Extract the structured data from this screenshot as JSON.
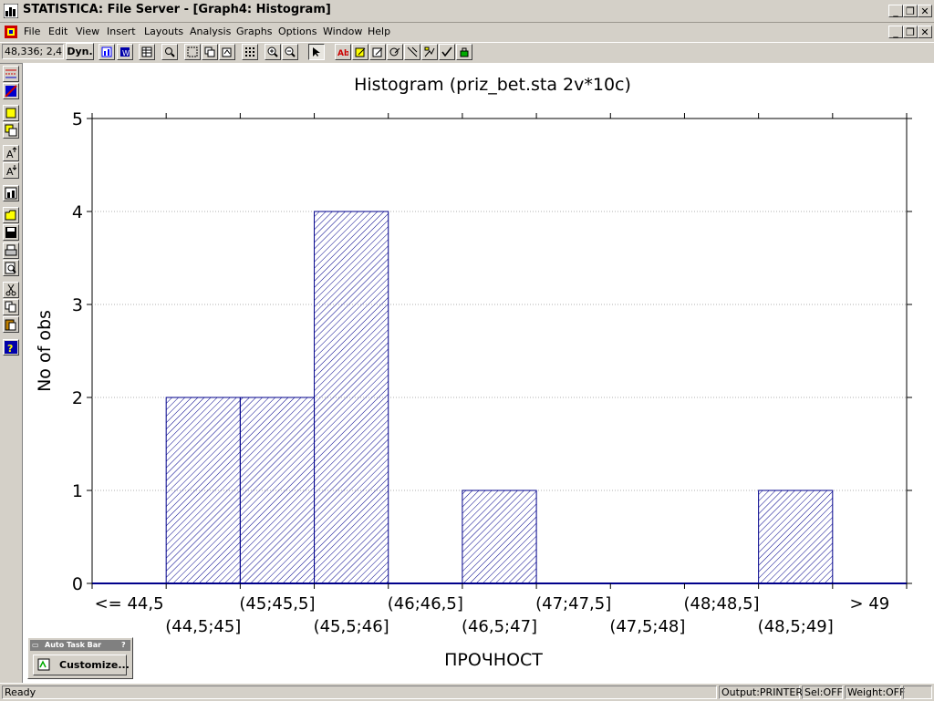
{
  "window": {
    "title": "STATISTICA: File Server - [Graph4: Histogram]",
    "minimize": "_",
    "restore": "❐",
    "close": "✕"
  },
  "menu": [
    "File",
    "Edit",
    "View",
    "Insert",
    "Layouts",
    "Analysis",
    "Graphs",
    "Options",
    "Window",
    "Help"
  ],
  "toolbar": {
    "coord_readout": "48,336; 2,4",
    "dyn_label": "Dyn."
  },
  "palette": {
    "title": "Auto Task Bar",
    "customize_label": "Customize..."
  },
  "status": {
    "ready": "Ready",
    "output": "Output:PRINTER",
    "sel": "Sel:OFF",
    "weight": "Weight:OFF"
  },
  "colors": {
    "bar_edge": "#00008b",
    "hatch": "#00008b",
    "grid": "#b0b0b0"
  },
  "chart_data": {
    "type": "bar",
    "title": "Histogram (priz_bet.sta 2v*10c)",
    "xlabel": "ПРОЧНОСТ",
    "ylabel": "No of obs",
    "ylim": [
      0,
      5
    ],
    "yticks": [
      0,
      1,
      2,
      3,
      4,
      5
    ],
    "grid": "horizontal dotted",
    "categories": [
      "<= 44,5",
      "(44,5;45]",
      "(45;45,5]",
      "(45,5;46]",
      "(46;46,5]",
      "(46,5;47]",
      "(47;47,5]",
      "(47,5;48]",
      "(48;48,5]",
      "(48,5;49]",
      "> 49"
    ],
    "values": [
      0,
      2,
      2,
      4,
      0,
      1,
      0,
      0,
      0,
      1,
      0
    ]
  }
}
